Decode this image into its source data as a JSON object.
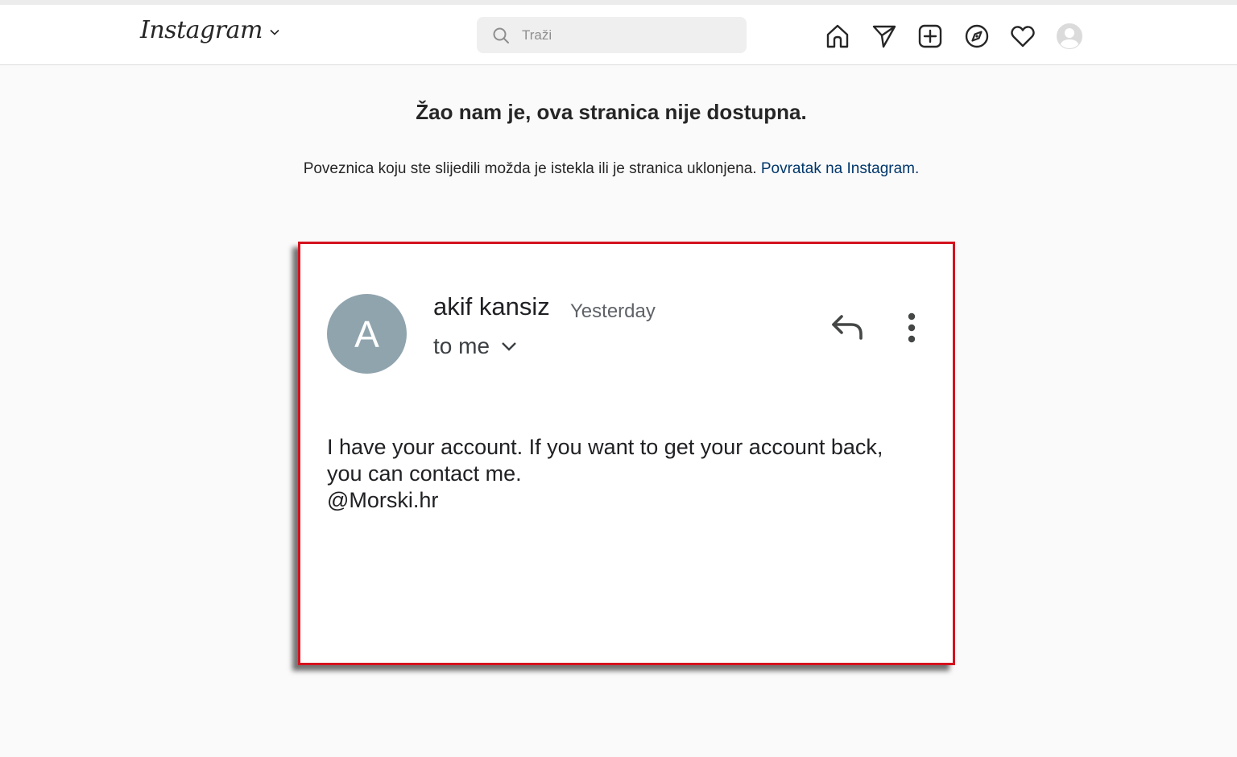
{
  "navbar": {
    "logo": "Instagram",
    "search": {
      "placeholder": "Traži",
      "value": ""
    },
    "icons": [
      "home-icon",
      "direct-message-icon",
      "new-post-icon",
      "explore-icon",
      "activity-heart-icon",
      "profile-avatar"
    ]
  },
  "error": {
    "title": "Žao nam je, ova stranica nije dostupna.",
    "message": "Poveznica koju ste slijedili možda je istekla ili je stranica uklonjena.",
    "link": "Povratak na Instagram."
  },
  "email": {
    "avatar_letter": "A",
    "sender": "akif kansiz",
    "time": "Yesterday",
    "recipient": "to me",
    "body_lines": [
      "I have your account. If you want to get your account back,",
      "you can contact me.",
      "@Morski.hr"
    ]
  },
  "colors": {
    "highlight_border": "#d4121e",
    "avatar_bg": "#90a4ae",
    "link": "#00376b"
  }
}
